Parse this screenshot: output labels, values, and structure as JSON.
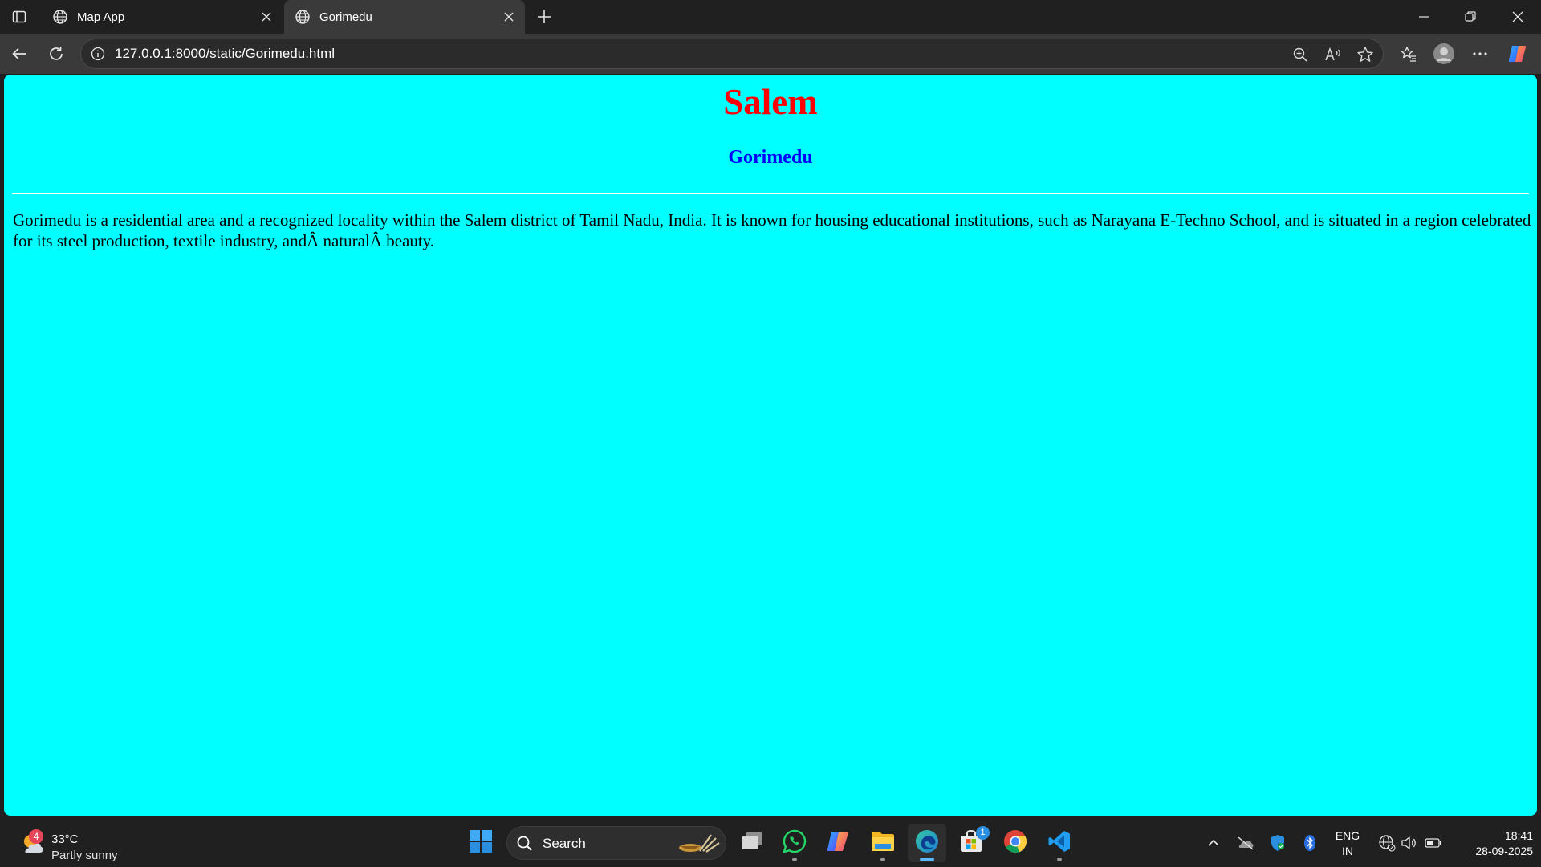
{
  "browser": {
    "tabs": [
      {
        "label": "Map App",
        "active": false
      },
      {
        "label": "Gorimedu",
        "active": true
      }
    ],
    "url": "127.0.0.1:8000/static/Gorimedu.html"
  },
  "page": {
    "background": "#00ffff",
    "heading": "Salem",
    "heading_color": "#ff0000",
    "subheading": "Gorimedu",
    "subheading_color": "#0000ff",
    "paragraph": "Gorimedu is a residential area and a recognized locality within the Salem district of Tamil Nadu, India. It is known for housing educational institutions, such as Narayana E-Techno School, and is situated in a region celebrated for its steel production, textile industry, andÂ naturalÂ beauty."
  },
  "taskbar": {
    "weather": {
      "badge": "4",
      "temperature": "33°C",
      "condition": "Partly sunny"
    },
    "search_label": "Search",
    "apps": [
      {
        "name": "start-icon"
      },
      {
        "name": "task-view-icon"
      },
      {
        "name": "whatsapp-icon"
      },
      {
        "name": "copilot-icon"
      },
      {
        "name": "file-explorer-icon"
      },
      {
        "name": "edge-icon"
      },
      {
        "name": "microsoft-store-icon",
        "badge": "1"
      },
      {
        "name": "chrome-icon"
      },
      {
        "name": "vscode-icon"
      }
    ],
    "tray": {
      "language_line1": "ENG",
      "language_line2": "IN",
      "time": "18:41",
      "date": "28-09-2025"
    }
  }
}
